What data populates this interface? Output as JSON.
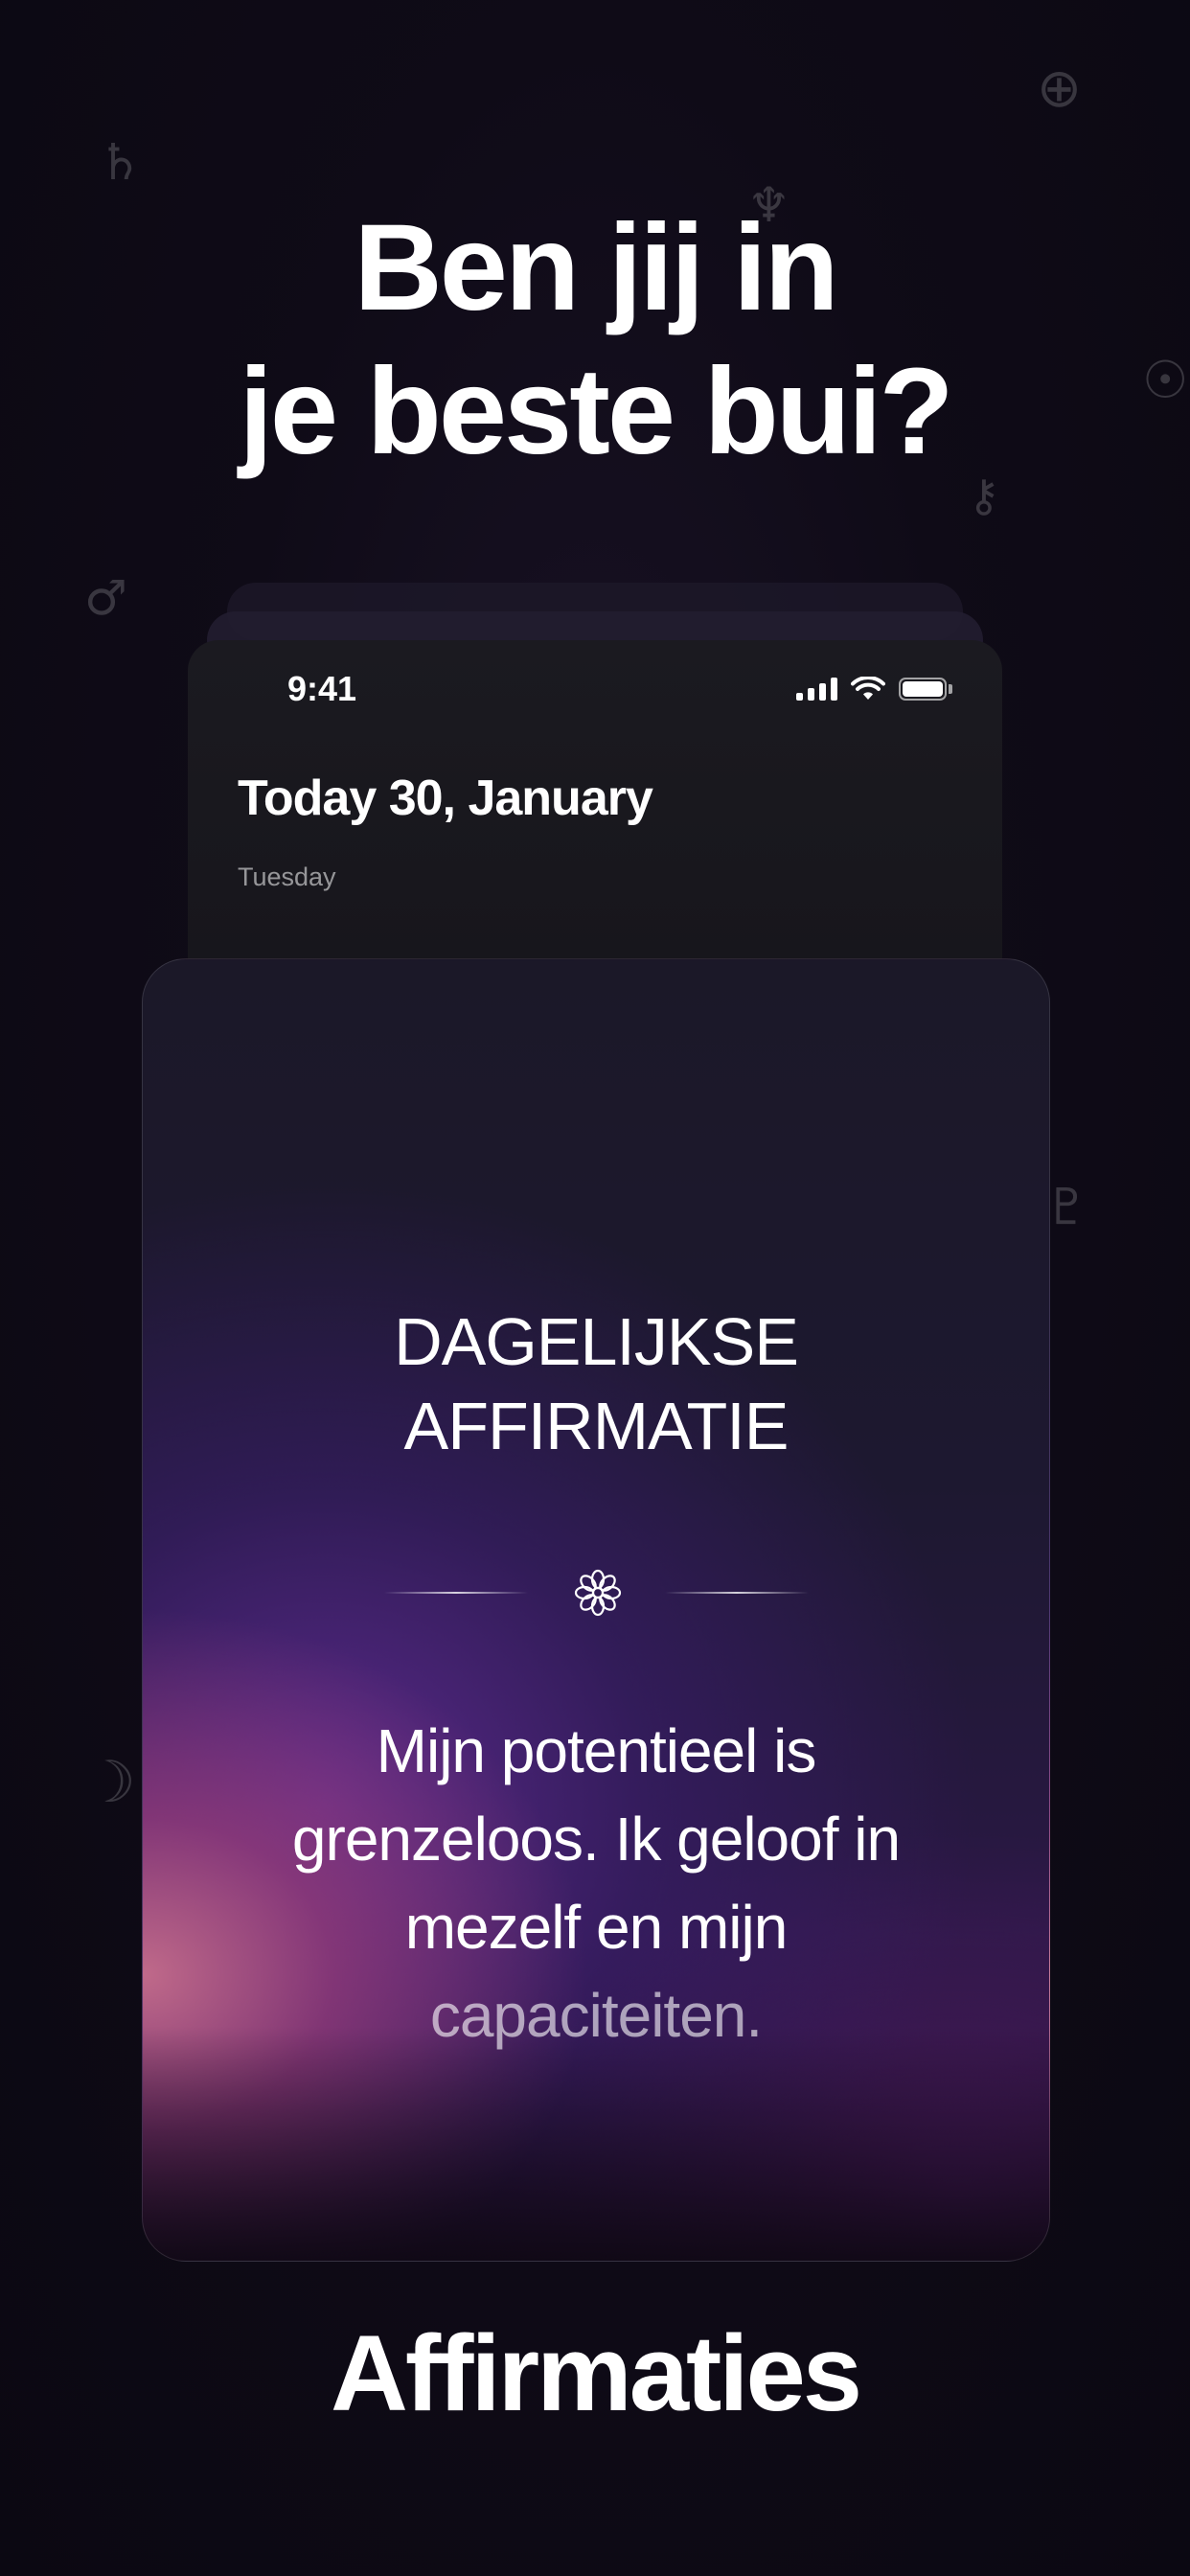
{
  "headline": {
    "line1": "Ben jij in",
    "line2": "je beste bui?"
  },
  "decor_glyphs": {
    "saturn": "♄",
    "neptune": "♆",
    "earth": "⊕",
    "sun": "☉",
    "mars": "♂",
    "chiron": "⚷",
    "pluto": "♇",
    "moon": "☽"
  },
  "phone": {
    "time": "9:41",
    "date_title": "Today 30, January",
    "weekday": "Tuesday"
  },
  "card": {
    "title_line1": "DAGELIJKSE",
    "title_line2": "AFFIRMATIE",
    "affirmation_lines": [
      "Mijn potentieel is",
      "grenzeloos. Ik geloof in",
      "mezelf en mijn"
    ],
    "affirmation_fade": "capaciteiten."
  },
  "footer_title": "Affirmaties",
  "icons": [
    "signal-icon",
    "wifi-icon",
    "battery-icon",
    "flower-icon"
  ]
}
